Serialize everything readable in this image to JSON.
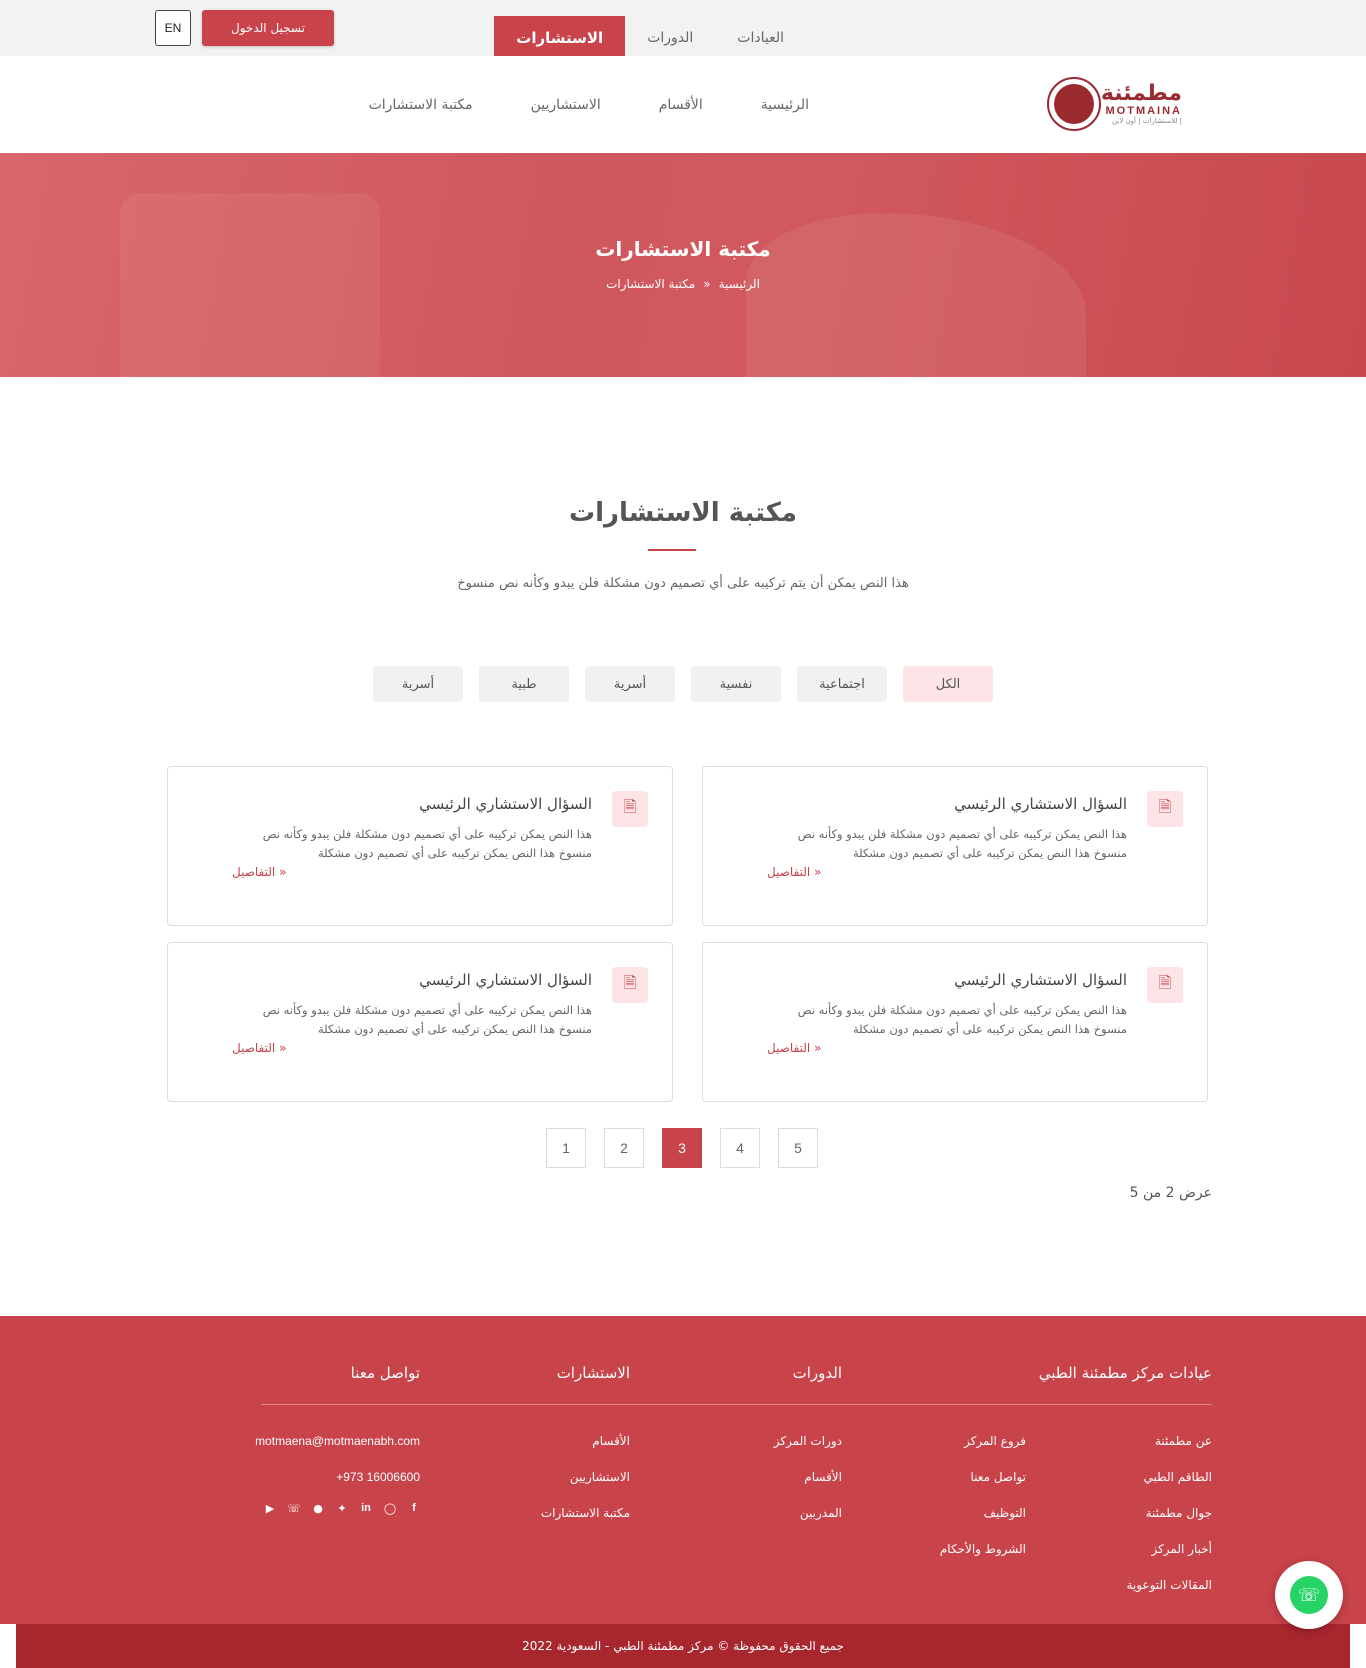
{
  "topbar": {
    "lang": "EN",
    "login": "تسجيل الدخول",
    "tabs": [
      {
        "label": "العيادات"
      },
      {
        "label": "الدورات"
      },
      {
        "label": "الاستشارات"
      }
    ]
  },
  "logo": {
    "ar": "مطمئنة",
    "en": "MOTMAINA",
    "sub": "للاستشارات | أون لاين |"
  },
  "nav": {
    "items": [
      {
        "label": "الرئيسية"
      },
      {
        "label": "الأقسام"
      },
      {
        "label": "الاستشاريين"
      },
      {
        "label": "مكتبة الاستشارات"
      }
    ]
  },
  "hero": {
    "title": "مكتبة الاستشارات",
    "crumb_home": "الرئيسية",
    "crumb_sep": "»",
    "crumb_current": "مكتبة الاستشارات"
  },
  "section": {
    "title": "مكتبة الاستشارات",
    "desc": "هذا النص يمكن أن يتم تركيبه على أي تصميم دون مشكلة فلن يبدو وكأنه نص منسوخ"
  },
  "filters": [
    {
      "label": "الكل"
    },
    {
      "label": "اجتماعية"
    },
    {
      "label": "نفسية"
    },
    {
      "label": "أسرية"
    },
    {
      "label": "طبية"
    },
    {
      "label": "أسرية"
    }
  ],
  "cards": [
    {
      "title": "السؤال الاستشاري الرئيسي",
      "text": "هذا النص يمكن تركيبه على أي تصميم دون مشكلة فلن يبدو وكأنه نص منسوخ هذا النص يمكن تركيبه على أي تصميم دون مشكلة",
      "link": "التفاصيل »"
    },
    {
      "title": "السؤال الاستشاري الرئيسي",
      "text": "هذا النص يمكن تركيبه على أي تصميم دون مشكلة فلن يبدو وكأنه نص منسوخ هذا النص يمكن تركيبه على أي تصميم دون مشكلة",
      "link": "التفاصيل »"
    },
    {
      "title": "السؤال الاستشاري الرئيسي",
      "text": "هذا النص يمكن تركيبه على أي تصميم دون مشكلة فلن يبدو وكأنه نص منسوخ هذا النص يمكن تركيبه على أي تصميم دون مشكلة",
      "link": "التفاصيل »"
    },
    {
      "title": "السؤال الاستشاري الرئيسي",
      "text": "هذا النص يمكن تركيبه على أي تصميم دون مشكلة فلن يبدو وكأنه نص منسوخ هذا النص يمكن تركيبه على أي تصميم دون مشكلة",
      "link": "التفاصيل »"
    }
  ],
  "pagination": {
    "pages": [
      "1",
      "2",
      "3",
      "4",
      "5"
    ],
    "showing": "عرض 2 من 5"
  },
  "footer": {
    "col1": {
      "head": "عيادات مركز مطمئنة الطبي",
      "items": [
        "عن مطمئنة",
        "الطاقم الطبي",
        "جوال مطمئنة",
        "أخبار المركز",
        "المقالات التوعوية"
      ]
    },
    "col2": {
      "items": [
        "فروع المركز",
        "تواصل معنا",
        "التوظيف",
        "الشروط والأحكام"
      ]
    },
    "col3": {
      "head": "الدورات",
      "items": [
        "دورات المركز",
        "الأقسام",
        "المدربين"
      ]
    },
    "col4": {
      "head": "الاستشارات",
      "items": [
        "الأقسام",
        "الاستشاريين",
        "مكتبة الاستشارات"
      ]
    },
    "col5": {
      "head": "تواصل معنا",
      "email": "motmaena@motmaenabh.com",
      "phone": "+973 16006600"
    },
    "copyright": "جميع الحقوق محفوظة © مركز مطمئنة الطبي - السعودية 2022"
  },
  "colors": {
    "primary": "#c8434a",
    "dark": "#a8262e",
    "tint": "#fde4e6"
  }
}
